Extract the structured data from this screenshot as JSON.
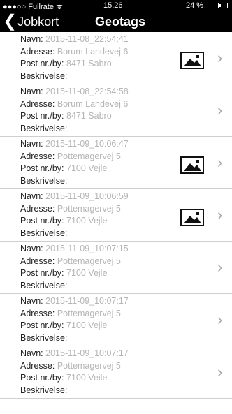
{
  "status_bar": {
    "carrier": "●●●○○ Fullrate ᯤ",
    "time": "15.26",
    "battery": "24 %",
    "battery_level": 0.24
  },
  "nav": {
    "back_label": "Jobkort",
    "title": "Geotags"
  },
  "labels": {
    "name": "Navn:",
    "address": "Adresse:",
    "postcode": "Post nr./by:",
    "description": "Beskrivelse:"
  },
  "geotags": [
    {
      "name": "2015-11-08_22:54:41",
      "address": "Borum Landevej 6",
      "postcode": "8471  Sabro",
      "description": "",
      "has_photo": true
    },
    {
      "name": "2015-11-08_22:54:58",
      "address": "Borum Landevej 6",
      "postcode": "8471  Sabro",
      "description": "",
      "has_photo": false
    },
    {
      "name": "2015-11-09_10:06:47",
      "address": "Pottemagervej 5",
      "postcode": "7100  Vejle",
      "description": "",
      "has_photo": true
    },
    {
      "name": "2015-11-09_10:06:59",
      "address": "Pottemagervej 5",
      "postcode": "7100  Vejle",
      "description": "",
      "has_photo": true
    },
    {
      "name": "2015-11-09_10:07:15",
      "address": "Pottemagervej 5",
      "postcode": "7100  Vejle",
      "description": "",
      "has_photo": false
    },
    {
      "name": "2015-11-09_10:07:17",
      "address": "Pottemagervej 5",
      "postcode": "7100  Vejle",
      "description": "",
      "has_photo": false
    },
    {
      "name": "2015-11-09_10:07:17",
      "address": "Pottemagervej 5",
      "postcode": "7100  Veile",
      "description": "",
      "has_photo": false
    }
  ]
}
